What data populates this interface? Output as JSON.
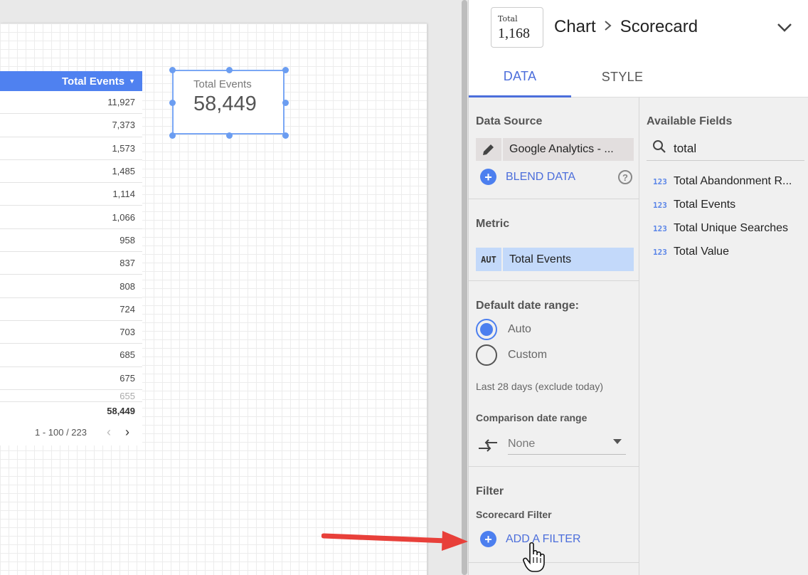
{
  "table": {
    "header": "Total Events",
    "rows": [
      "11,927",
      "7,373",
      "1,573",
      "1,485",
      "1,114",
      "1,066",
      "958",
      "837",
      "808",
      "724",
      "703",
      "685",
      "675",
      "655"
    ],
    "total": "58,449",
    "pagination": "1 - 100 / 223"
  },
  "scorecard": {
    "label": "Total Events",
    "value": "58,449"
  },
  "panel": {
    "thumbnail": {
      "label": "Total",
      "value": "1,168"
    },
    "breadcrumb": {
      "parent": "Chart",
      "current": "Scorecard"
    },
    "tabs": {
      "data": "DATA",
      "style": "STYLE"
    },
    "data_source": {
      "title": "Data Source",
      "name": "Google Analytics - ...",
      "blend": "BLEND DATA"
    },
    "metric": {
      "title": "Metric",
      "type": "AUT",
      "name": "Total Events"
    },
    "date_range": {
      "title": "Default date range:",
      "auto": "Auto",
      "custom": "Custom",
      "description": "Last 28 days (exclude today)",
      "comparison_title": "Comparison date range",
      "comparison_value": "None"
    },
    "filter": {
      "title": "Filter",
      "subtitle": "Scorecard Filter",
      "add": "ADD A FILTER"
    },
    "available_fields": {
      "title": "Available Fields",
      "search_value": "total",
      "items": [
        {
          "type": "123",
          "name": "Total Abandonment R..."
        },
        {
          "type": "123",
          "name": "Total Events"
        },
        {
          "type": "123",
          "name": "Total Unique Searches"
        },
        {
          "type": "123",
          "name": "Total Value"
        }
      ]
    }
  },
  "colors": {
    "accent": "#4c6edb",
    "table_header": "#4f81f0",
    "selection": "#7aa7f5",
    "arrow": "#e8403a"
  }
}
